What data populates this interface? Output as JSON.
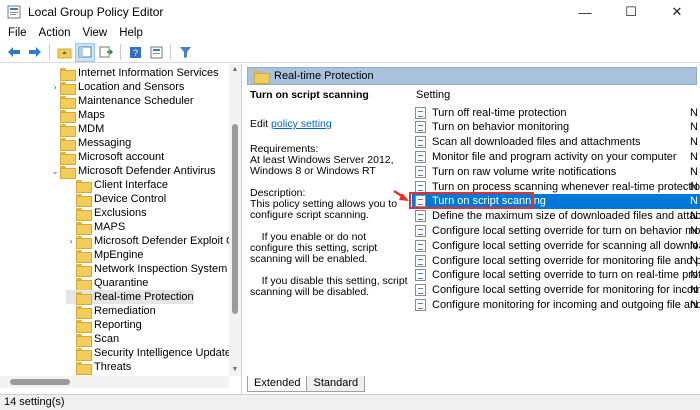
{
  "window": {
    "title": "Local Group Policy Editor",
    "minimize": "—",
    "maximize": "☐",
    "close": "✕"
  },
  "menu": [
    "File",
    "Action",
    "View",
    "Help"
  ],
  "tree": [
    {
      "label": "Internet Information Services",
      "indent": 0,
      "expandable": false
    },
    {
      "label": "Location and Sensors",
      "indent": 0,
      "expandable": true
    },
    {
      "label": "Maintenance Scheduler",
      "indent": 0,
      "expandable": false
    },
    {
      "label": "Maps",
      "indent": 0,
      "expandable": false
    },
    {
      "label": "MDM",
      "indent": 0,
      "expandable": false
    },
    {
      "label": "Messaging",
      "indent": 0,
      "expandable": false
    },
    {
      "label": "Microsoft account",
      "indent": 0,
      "expandable": false
    },
    {
      "label": "Microsoft Defender Antivirus",
      "indent": 0,
      "expandable": true,
      "expanded": true
    },
    {
      "label": "Client Interface",
      "indent": 1,
      "expandable": false
    },
    {
      "label": "Device Control",
      "indent": 1,
      "expandable": false
    },
    {
      "label": "Exclusions",
      "indent": 1,
      "expandable": false
    },
    {
      "label": "MAPS",
      "indent": 1,
      "expandable": false
    },
    {
      "label": "Microsoft Defender Exploit Guar",
      "indent": 1,
      "expandable": true
    },
    {
      "label": "MpEngine",
      "indent": 1,
      "expandable": false
    },
    {
      "label": "Network Inspection System",
      "indent": 1,
      "expandable": false
    },
    {
      "label": "Quarantine",
      "indent": 1,
      "expandable": false
    },
    {
      "label": "Real-time Protection",
      "indent": 1,
      "expandable": false,
      "selected": true
    },
    {
      "label": "Remediation",
      "indent": 1,
      "expandable": false
    },
    {
      "label": "Reporting",
      "indent": 1,
      "expandable": false
    },
    {
      "label": "Scan",
      "indent": 1,
      "expandable": false
    },
    {
      "label": "Security Intelligence Updates",
      "indent": 1,
      "expandable": false
    },
    {
      "label": "Threats",
      "indent": 1,
      "expandable": false
    }
  ],
  "pane": {
    "header": "Real-time Protection",
    "desc_title": "Turn on script scanning",
    "edit_prefix": "Edit",
    "edit_link": "policy setting",
    "requirements": "Requirements:\nAt least Windows Server 2012, Windows 8 or Windows RT",
    "description": "Description:\nThis policy setting allows you to configure script scanning.",
    "para1": "    If you enable or do not configure this setting, script scanning will be enabled.",
    "para2": "    If you disable this setting, script scanning will be disabled."
  },
  "list": {
    "column": "Setting",
    "rows": [
      {
        "name": "Turn off real-time protection",
        "state": "N"
      },
      {
        "name": "Turn on behavior monitoring",
        "state": "N"
      },
      {
        "name": "Scan all downloaded files and attachments",
        "state": "N"
      },
      {
        "name": "Monitor file and program activity on your computer",
        "state": "N"
      },
      {
        "name": "Turn on raw volume write notifications",
        "state": "N"
      },
      {
        "name": "Turn on process scanning whenever real-time protection is ...",
        "state": "N"
      },
      {
        "name": "Turn on script scanning",
        "state": "N",
        "selected": true
      },
      {
        "name": "Define the maximum size of downloaded files and attachme...",
        "state": "N"
      },
      {
        "name": "Configure local setting override for turn on behavior monito...",
        "state": "N"
      },
      {
        "name": "Configure local setting override for scanning all downloade...",
        "state": "N"
      },
      {
        "name": "Configure local setting override for monitoring file and prog...",
        "state": "N"
      },
      {
        "name": "Configure local setting override to turn on real-time protecti...",
        "state": "N"
      },
      {
        "name": "Configure local setting override for monitoring for incomin...",
        "state": "N"
      },
      {
        "name": "Configure monitoring for incoming and outgoing file and pro...",
        "state": "N"
      }
    ]
  },
  "tabs": [
    "Extended",
    "Standard"
  ],
  "status": "14 setting(s)",
  "colors": {
    "selection": "#0078d7",
    "header": "#a9c3de",
    "highlight": "#e03030"
  }
}
